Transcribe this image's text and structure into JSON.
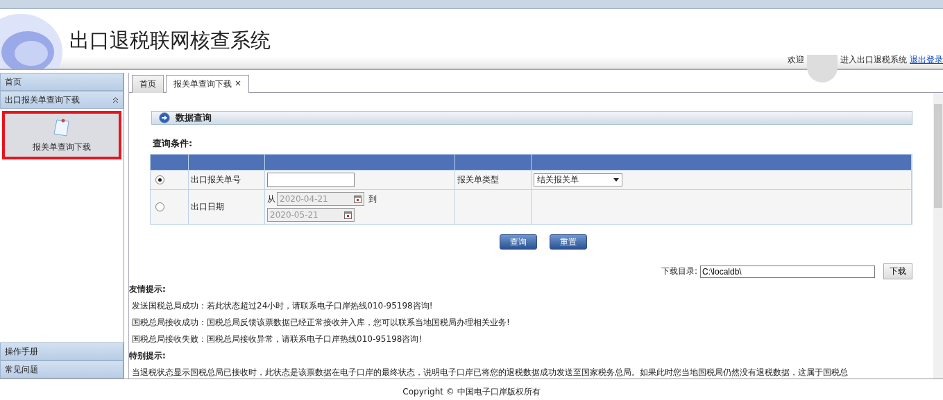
{
  "header": {
    "title": "出口退税联网核查系统",
    "welcome_prefix": "欢迎",
    "welcome_suffix": "进入出口退税系统",
    "logout": "退出登录"
  },
  "sidebar": [
    {
      "label": "首页",
      "expanded": false
    },
    {
      "label": "出口报关单查询下载",
      "expanded": true,
      "items": [
        {
          "label": "报关单查询下载",
          "selected": true
        }
      ]
    },
    {
      "label": "操作手册",
      "expanded": false
    },
    {
      "label": "常见问题",
      "expanded": false
    }
  ],
  "tabs": [
    {
      "label": "首页",
      "selected": false
    },
    {
      "label": "报关单查询下载",
      "selected": true,
      "close": "×"
    }
  ],
  "panel_title": "数据查询",
  "criteria_title": "查询条件:",
  "rows": [
    {
      "kind": "text",
      "selected": true,
      "label": "出口报关单号",
      "type_label": "报关单类型",
      "type_value": "结关报关单"
    },
    {
      "kind": "daterange",
      "selected": false,
      "label": "出口日期",
      "from_label": "从",
      "from": "2020-04-21",
      "to_label": "到",
      "to": "2020-05-21"
    }
  ],
  "buttons": [
    "查询",
    "重置"
  ],
  "download": {
    "label": "下载目录:",
    "value": "C:\\localdb\\",
    "button": "下载"
  },
  "tips": [
    {
      "kind": "heading",
      "text": "友情提示:"
    },
    {
      "kind": "line",
      "text": "发送国税总局成功：若此状态超过24小时，请联系电子口岸热线010-95198咨询!"
    },
    {
      "kind": "line",
      "text": "国税总局接收成功：国税总局反馈该票数据已经正常接收并入库，您可以联系当地国税局办理相关业务!"
    },
    {
      "kind": "line",
      "text": "国税总局接收失败：国税总局接收异常，请联系电子口岸热线010-95198咨询!"
    },
    {
      "kind": "heading",
      "text": "特别提示:"
    },
    {
      "kind": "line",
      "text": "当退税状态显示国税总局已接收时，此状态是该票数据在电子口岸的最终状态，说明电子口岸已将您的退税数据成功发送至国家税务总局。如果此时您当地国税局仍然没有退税数据，这属于国税总"
    }
  ],
  "footer": "Copyright © 中国电子口岸版权所有"
}
